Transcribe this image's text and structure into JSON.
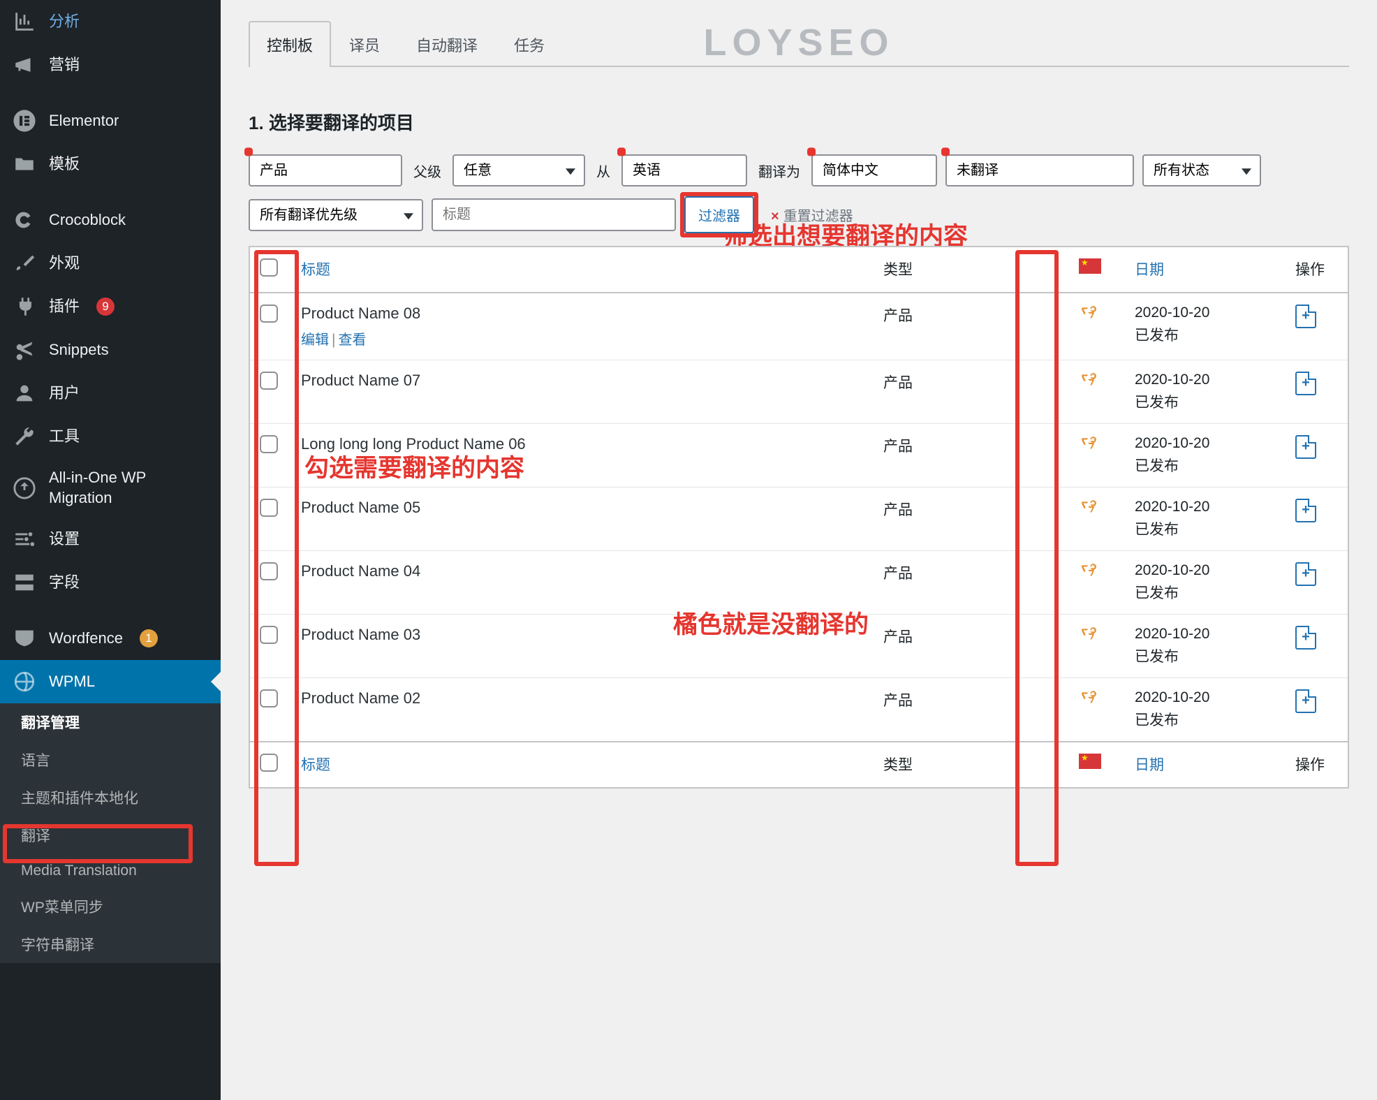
{
  "logo": "LOYSEO",
  "sidebar": {
    "top": [
      {
        "label": "分析",
        "icon": "chart-icon"
      },
      {
        "label": "营销",
        "icon": "megaphone-icon"
      }
    ],
    "mid": [
      {
        "label": "Elementor",
        "icon": "elementor-icon"
      },
      {
        "label": "模板",
        "icon": "folder-icon"
      }
    ],
    "ext": [
      {
        "label": "Crocoblock",
        "icon": "croco-icon"
      },
      {
        "label": "外观",
        "icon": "brush-icon"
      },
      {
        "label": "插件",
        "icon": "plug-icon",
        "badge": "9"
      },
      {
        "label": "Snippets",
        "icon": "scissors-icon"
      },
      {
        "label": "用户",
        "icon": "user-icon"
      },
      {
        "label": "工具",
        "icon": "wrench-icon"
      },
      {
        "label": "All-in-One WP Migration",
        "icon": "migration-icon"
      },
      {
        "label": "设置",
        "icon": "sliders-icon"
      },
      {
        "label": "字段",
        "icon": "fields-icon"
      }
    ],
    "bottom": [
      {
        "label": "Wordfence",
        "icon": "wordfence-icon",
        "badge": "1",
        "badgeClass": "gold"
      },
      {
        "label": "WPML",
        "icon": "wpml-icon",
        "active": true
      }
    ],
    "submenu": [
      {
        "label": "翻译管理",
        "current": true
      },
      {
        "label": "语言"
      },
      {
        "label": "主题和插件本地化"
      },
      {
        "label": "翻译"
      },
      {
        "label": "Media Translation"
      },
      {
        "label": "WP菜单同步"
      },
      {
        "label": "字符串翻译"
      }
    ]
  },
  "tabs": [
    "控制板",
    "译员",
    "自动翻译",
    "任务"
  ],
  "activeTab": 0,
  "section_title": "1. 选择要翻译的项目",
  "filters": {
    "type": "产品",
    "parent_label": "父级",
    "parent": "任意",
    "from_label": "从",
    "from": "英语",
    "to_label": "翻译为",
    "to": "简体中文",
    "status": "未翻译",
    "allstatus": "所有状态",
    "priority": "所有翻译优先级",
    "title_placeholder": "标题",
    "filter_btn": "过滤器",
    "reset": "重置过滤器"
  },
  "columns": {
    "check": "",
    "title": "标题",
    "type": "类型",
    "flag": "",
    "date": "日期",
    "action": "操作"
  },
  "rows": [
    {
      "title": "Product Name 08",
      "show_links": true,
      "edit": "编辑",
      "view": "查看",
      "type": "产品",
      "date": "2020-10-20",
      "status": "已发布"
    },
    {
      "title": "Product Name 07",
      "type": "产品",
      "date": "2020-10-20",
      "status": "已发布"
    },
    {
      "title": "Long long long Product Name 06",
      "type": "产品",
      "date": "2020-10-20",
      "status": "已发布"
    },
    {
      "title": "Product Name 05",
      "type": "产品",
      "date": "2020-10-20",
      "status": "已发布"
    },
    {
      "title": "Product Name 04",
      "type": "产品",
      "date": "2020-10-20",
      "status": "已发布"
    },
    {
      "title": "Product Name 03",
      "type": "产品",
      "date": "2020-10-20",
      "status": "已发布"
    },
    {
      "title": "Product Name 02",
      "type": "产品",
      "date": "2020-10-20",
      "status": "已发布"
    }
  ],
  "annotations": {
    "a1": "筛选出想要翻译的内容",
    "a2": "勾选需要翻译的内容",
    "a3": "橘色就是没翻译的"
  }
}
